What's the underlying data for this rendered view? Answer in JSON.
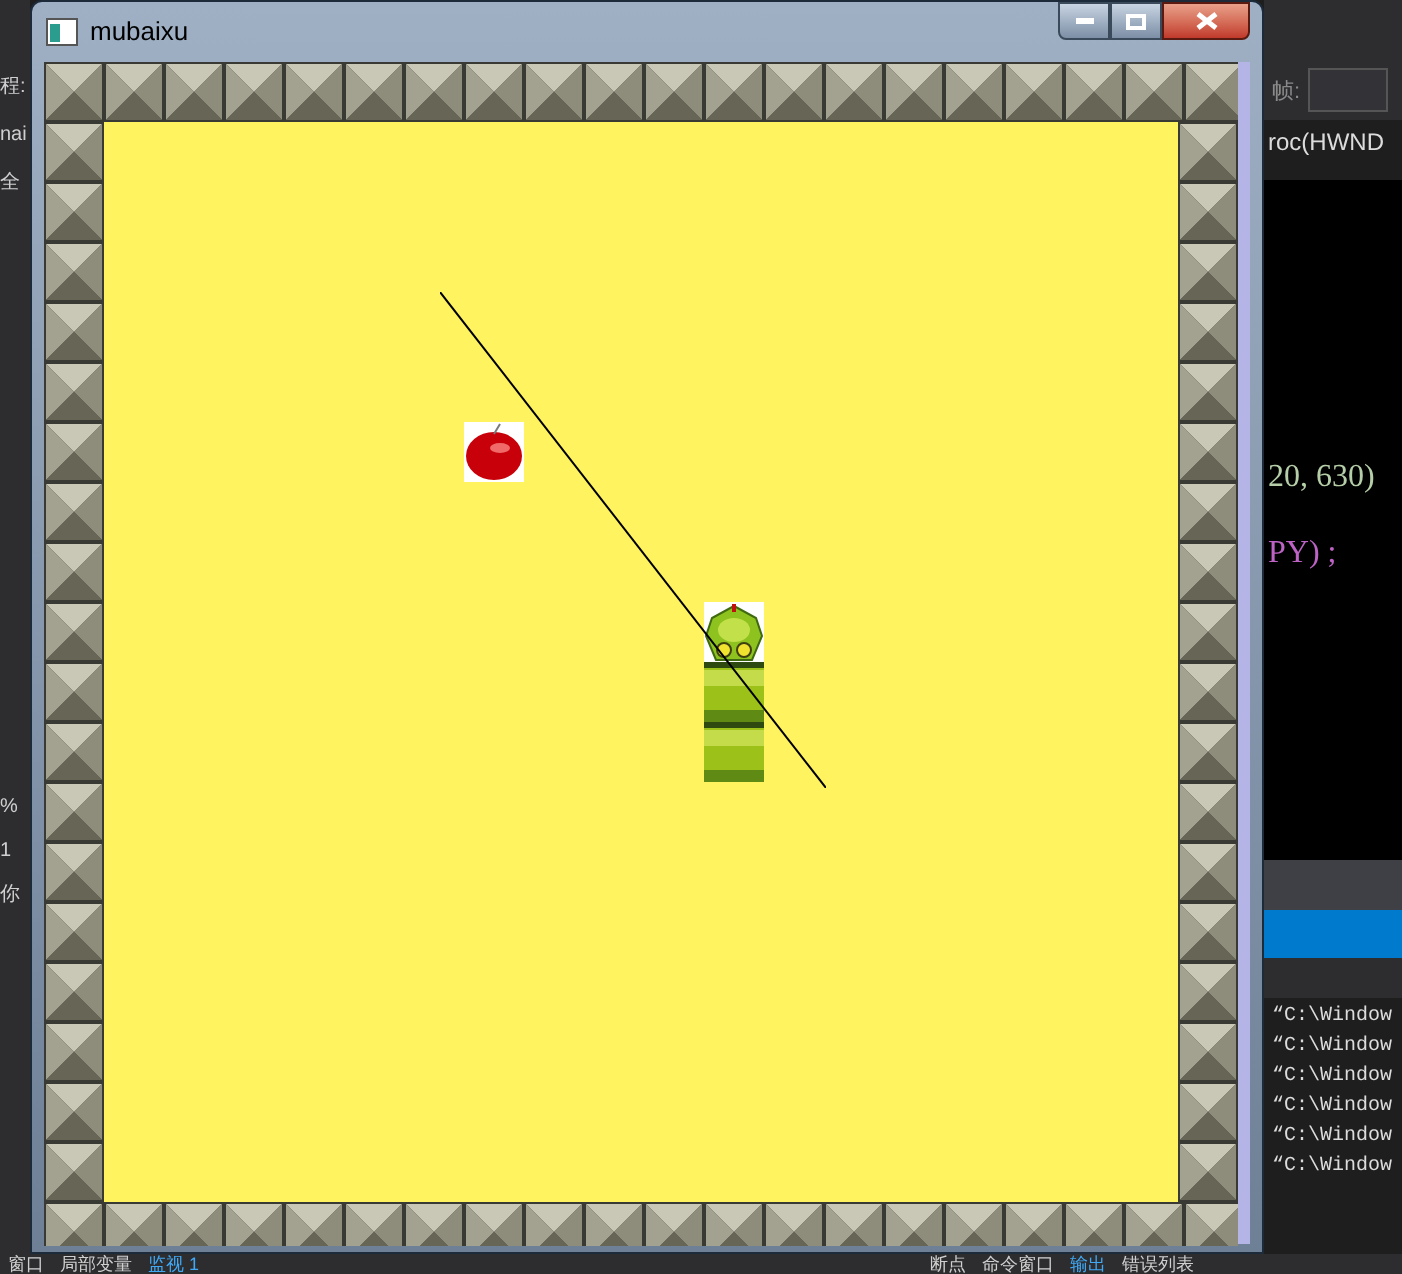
{
  "window": {
    "title": "mubaixu"
  },
  "game": {
    "snake": [
      {
        "kind": "head"
      },
      {
        "kind": "body"
      },
      {
        "kind": "body"
      }
    ]
  },
  "ide_left": {
    "upper": [
      "程:",
      "nai",
      "全"
    ],
    "lower": [
      "%",
      "1",
      "你"
    ]
  },
  "ide_right": {
    "frame_label": "帧:",
    "code": [
      {
        "text": "roc(HWND",
        "kind": "plain"
      },
      {
        "text": "20, 630)",
        "kind": "number"
      },
      {
        "text": "PY) ;",
        "kind": "macro"
      }
    ],
    "output_lines": [
      "“C:\\Window",
      "“C:\\Window",
      "“C:\\Window",
      "“C:\\Window",
      "“C:\\Window",
      "“C:\\Window"
    ]
  },
  "ide_bottom_tabs": {
    "left": [
      {
        "label": "窗口",
        "selected": false
      },
      {
        "label": "局部变量",
        "selected": false
      },
      {
        "label": "监视 1",
        "selected": true
      }
    ],
    "right": [
      {
        "label": "断点",
        "selected": false
      },
      {
        "label": "命令窗口",
        "selected": false
      },
      {
        "label": "输出",
        "selected": true
      },
      {
        "label": "错误列表",
        "selected": false
      }
    ]
  }
}
